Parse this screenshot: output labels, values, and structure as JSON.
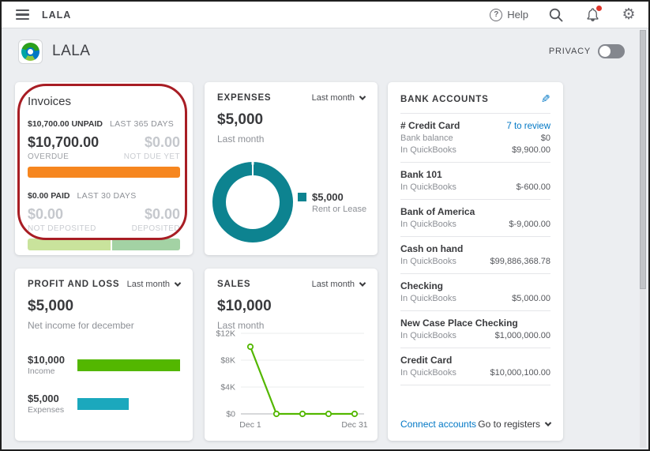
{
  "topbar": {
    "company": "LALA",
    "help_label": "Help"
  },
  "header": {
    "company_name": "LALA",
    "privacy_label": "PRIVACY",
    "privacy_on": false
  },
  "invoices": {
    "title": "Invoices",
    "unpaid_amount_summary": "$10,700.00 UNPAID",
    "unpaid_period": "LAST 365 DAYS",
    "overdue_amount": "$10,700.00",
    "overdue_label": "OVERDUE",
    "not_due_amount": "$0.00",
    "not_due_label": "NOT DUE YET",
    "paid_amount_summary": "$0.00 PAID",
    "paid_period": "LAST 30 DAYS",
    "not_deposited_amount": "$0.00",
    "not_deposited_label": "NOT DEPOSITED",
    "deposited_amount": "$0.00",
    "deposited_label": "DEPOSITED",
    "bars": {
      "overdue_pct": 100,
      "overdue_color": "#f6861f",
      "not_deposited_pct": 55,
      "not_deposited_color": "#c9e39c",
      "deposited_pct": 45,
      "deposited_color": "#a3d2a4"
    }
  },
  "expenses": {
    "title": "EXPENSES",
    "period": "Last month",
    "amount": "$5,000",
    "subtitle": "Last month",
    "legend_amount": "$5,000",
    "legend_label": "Rent or Lease",
    "donut_color": "#0d8390",
    "donut_gap_deg": 3
  },
  "bank_accounts": {
    "title": "BANK ACCOUNTS",
    "accounts": [
      {
        "name": "# Credit Card",
        "link": "7 to review",
        "lines": [
          {
            "label": "Bank balance",
            "value": "$0"
          },
          {
            "label": "In QuickBooks",
            "value": "$9,900.00"
          }
        ]
      },
      {
        "name": "Bank 101",
        "lines": [
          {
            "label": "In QuickBooks",
            "value": "$-600.00"
          }
        ]
      },
      {
        "name": "Bank of America",
        "lines": [
          {
            "label": "In QuickBooks",
            "value": "$-9,000.00"
          }
        ]
      },
      {
        "name": "Cash on hand",
        "lines": [
          {
            "label": "In QuickBooks",
            "value": "$99,886,368.78"
          }
        ]
      },
      {
        "name": "Checking",
        "lines": [
          {
            "label": "In QuickBooks",
            "value": "$5,000.00"
          }
        ]
      },
      {
        "name": "New Case Place Checking",
        "lines": [
          {
            "label": "In QuickBooks",
            "value": "$1,000,000.00"
          }
        ]
      },
      {
        "name": "Credit Card",
        "lines": [
          {
            "label": "In QuickBooks",
            "value": "$10,000,100.00"
          }
        ]
      }
    ],
    "footer": {
      "connect_label": "Connect accounts",
      "registers_label": "Go to registers"
    }
  },
  "profit_loss": {
    "title": "PROFIT AND LOSS",
    "period": "Last month",
    "amount": "$5,000",
    "subtitle": "Net income for december",
    "series": [
      {
        "amount_label": "$10,000",
        "label": "Income",
        "value": 10000,
        "color": "#53b700"
      },
      {
        "amount_label": "$5,000",
        "label": "Expenses",
        "value": 5000,
        "color": "#1ba8bd"
      }
    ],
    "max_value": 10000
  },
  "sales": {
    "title": "SALES",
    "period": "Last month",
    "amount": "$10,000",
    "subtitle": "Last month"
  },
  "chart_data": [
    {
      "id": "sales",
      "type": "line",
      "title": "Sales - Last month",
      "x_labels": [
        "Dec 1",
        "Dec 31"
      ],
      "values": [
        10000,
        0,
        0,
        0,
        0
      ],
      "yticks": [
        {
          "value": 12000,
          "label": "$12K"
        },
        {
          "value": 8000,
          "label": "$8K"
        },
        {
          "value": 4000,
          "label": "$4K"
        },
        {
          "value": 0,
          "label": "$0"
        }
      ],
      "ylim": [
        0,
        12000
      ],
      "line_color": "#53b700",
      "grid": true,
      "legend_position": "none"
    },
    {
      "id": "expenses_donut",
      "type": "pie",
      "title": "Expenses - Last month",
      "categories": [
        "Rent or Lease"
      ],
      "values": [
        5000
      ],
      "colors": [
        "#0d8390"
      ],
      "total": 5000
    },
    {
      "id": "profit_loss_bars",
      "type": "bar",
      "title": "Profit and Loss - Last month",
      "categories": [
        "Income",
        "Expenses"
      ],
      "values": [
        10000,
        5000
      ],
      "colors": [
        "#53b700",
        "#1ba8bd"
      ],
      "xlim": [
        0,
        10000
      ]
    }
  ],
  "colors": {
    "link_blue": "#0077c5",
    "orange": "#f6861f",
    "teal": "#0d8390",
    "green": "#53b700",
    "cyan": "#1ba8bd",
    "annotation_red": "#a81d24"
  }
}
